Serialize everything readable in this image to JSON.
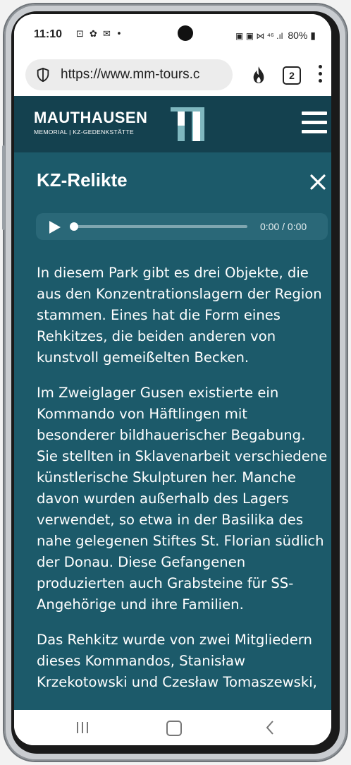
{
  "status_bar": {
    "time": "11:10",
    "left_icons": "⊡ ✿ ✉ •",
    "right_icons": "▣ ▣ ⋈ ⁴⁶ .ıl",
    "battery": "80%"
  },
  "browser": {
    "url": "https://www.mm-tours.c",
    "tab_count": "2"
  },
  "site": {
    "logo_title": "MAUTHAUSEN",
    "logo_subtitle": "MEMORIAL | KZ-GEDENKSTÄTTE"
  },
  "panel": {
    "title": "KZ-Relikte",
    "audio_time": "0:00 / 0:00",
    "paragraphs": [
      "In diesem Park gibt es drei Objekte, die aus den Konzentrationslagern der Region stammen. Eines hat die Form eines Rehkitzes, die beiden anderen von kunstvoll gemeißelten Becken.",
      "Im Zweiglager Gusen existierte ein Kommando von Häftlingen mit besonderer bildhauerischer Begabung. Sie stellten in Sklavenarbeit verschiedene künstlerische Skulpturen her. Manche davon wurden außerhalb des Lagers verwendet, so etwa in der Basilika des nahe gelegenen Stiftes St. Florian südlich der Donau. Diese Gefangenen produzierten auch Grabsteine für SS-Angehörige und ihre Familien.",
      "Das Rehkitz wurde von zwei Mitgliedern dieses Kommandos, Stanisław Krzekotowski und Czesław Tomaszewski,"
    ]
  },
  "colors": {
    "header_bg": "#14414f",
    "content_bg": "#1c5a6a",
    "logo_accent": "#7fb7bf"
  }
}
